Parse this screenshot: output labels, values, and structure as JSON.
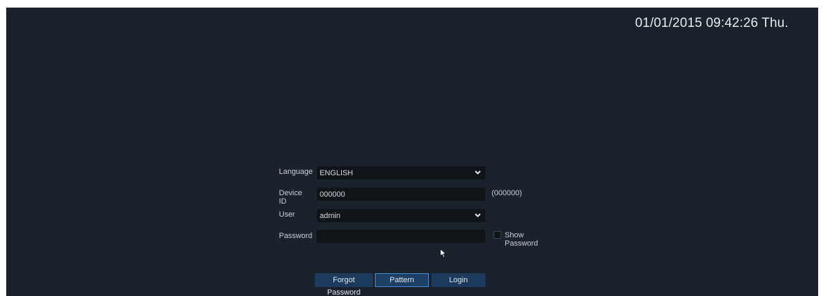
{
  "datetime": "01/01/2015 09:42:26 Thu.",
  "form": {
    "language": {
      "label": "Language",
      "value": "ENGLISH"
    },
    "device_id": {
      "label": "Device ID",
      "value": "000000",
      "hint": "(000000)"
    },
    "user": {
      "label": "User",
      "value": "admin"
    },
    "password": {
      "label": "Password",
      "value": "",
      "show_password_label": "Show Password"
    }
  },
  "buttons": {
    "forgot": "Forgot Password",
    "pattern": "Pattern",
    "login": "Login"
  },
  "colors": {
    "background": "#1a222c",
    "field": "#101419",
    "button": "#1c3a5c",
    "focus_border": "#4b8ad6"
  },
  "icons": {
    "dropdown": "chevron-down-icon",
    "cursor": "mouse-pointer-icon"
  }
}
